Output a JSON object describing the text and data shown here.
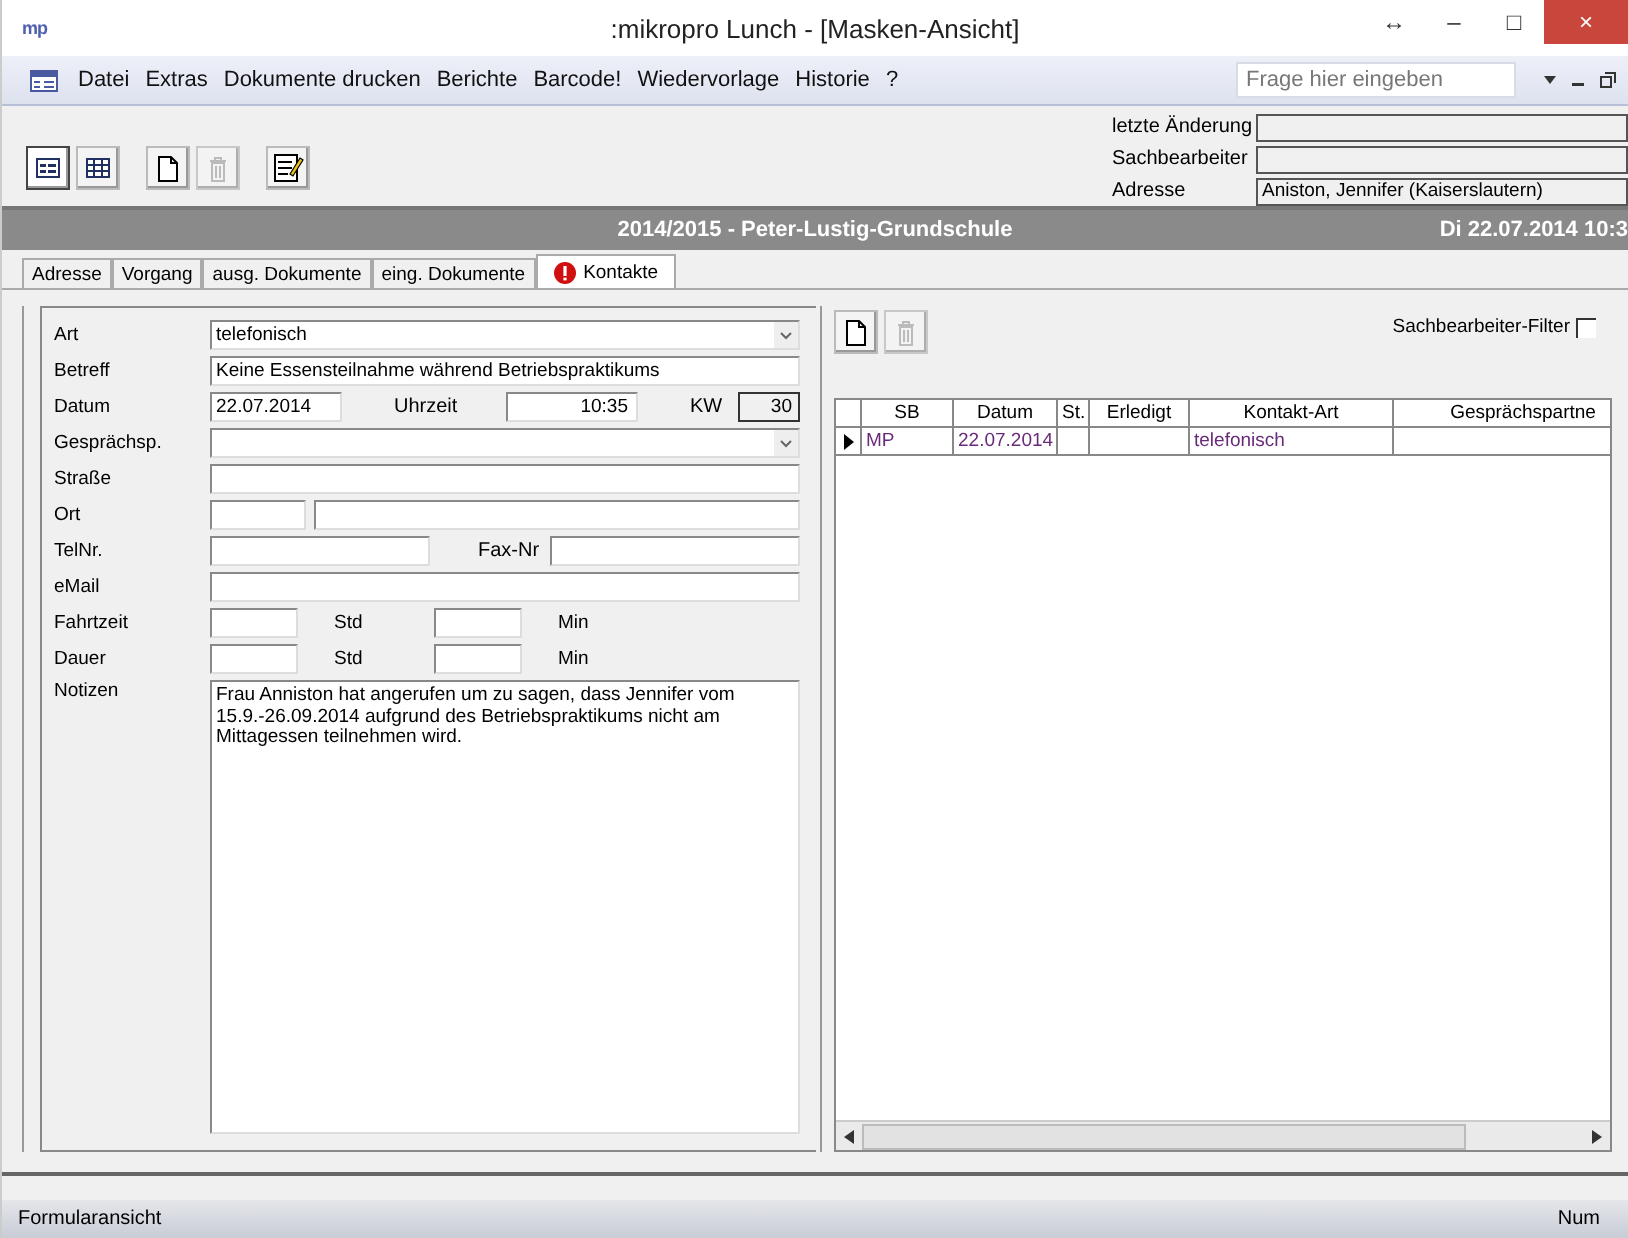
{
  "window": {
    "app_icon": "mp",
    "title": ":mikropro Lunch - [Masken-Ansicht]",
    "controls": [
      "↔",
      "–",
      "□",
      "×"
    ]
  },
  "menu": {
    "items": [
      "Datei",
      "Extras",
      "Dokumente drucken",
      "Berichte",
      "Barcode!",
      "Wiedervorlage",
      "Historie",
      "?"
    ],
    "help_search": {
      "placeholder": "Frage hier eingeben"
    }
  },
  "toolbar": {
    "buttons": [
      {
        "kind": "form-view",
        "selected": true,
        "disabled": false
      },
      {
        "kind": "table-view",
        "selected": false,
        "disabled": false
      },
      {
        "kind": "new",
        "selected": false,
        "disabled": false
      },
      {
        "kind": "delete",
        "selected": false,
        "disabled": true
      },
      {
        "kind": "edit",
        "selected": false,
        "disabled": false
      }
    ],
    "info": [
      {
        "label": "letzte Änderung"
      },
      {
        "label": "Sachbearbeiter"
      },
      {
        "label": "Adresse",
        "value": "Aniston, Jennifer (Kaiserslautern)"
      }
    ]
  },
  "header": {
    "title": "2014/2015 - Peter-Lustig-Grundschule",
    "datetime": "Di 22.07.2014 10:3"
  },
  "tabs": [
    {
      "label": "Adresse",
      "selected": false,
      "alert": false
    },
    {
      "label": "Vorgang",
      "selected": false,
      "alert": false
    },
    {
      "label": "ausg. Dokumente",
      "selected": false,
      "alert": false
    },
    {
      "label": "eing. Dokumente",
      "selected": false,
      "alert": false
    },
    {
      "label": "Kontakte",
      "selected": true,
      "alert": true
    }
  ],
  "form": {
    "art": {
      "label": "Art",
      "value": "telefonisch"
    },
    "betreff": {
      "label": "Betreff",
      "value": "Keine Essensteilnahme während Betriebspraktikums"
    },
    "datum": {
      "label": "Datum",
      "value": "22.07.2014"
    },
    "uhrzeit": {
      "label": "Uhrzeit",
      "value": "10:35"
    },
    "kw": {
      "label": "KW",
      "value": "30"
    },
    "gespraechspartner": {
      "label": "Gesprächsp."
    },
    "strasse": {
      "label": "Straße"
    },
    "ort": {
      "label": "Ort"
    },
    "telnr": {
      "label": "TelNr."
    },
    "faxnr": {
      "label": "Fax-Nr"
    },
    "email": {
      "label": "eMail"
    },
    "fahrtzeit": {
      "label": "Fahrtzeit",
      "unit_hours": "Std",
      "unit_minutes": "Min"
    },
    "dauer": {
      "label": "Dauer",
      "unit_hours": "Std",
      "unit_minutes": "Min"
    },
    "notizen": {
      "label": "Notizen",
      "value": "Frau Anniston hat angerufen um zu sagen, dass Jennifer vom 15.9.-26.09.2014 aufgrund des Betriebspraktikums nicht am Mittagessen teilnehmen wird."
    }
  },
  "contacts": {
    "filter": {
      "label": "Sachbearbeiter-Filter",
      "checked": false
    },
    "delete_disabled": true,
    "columns": [
      "SB",
      "Datum",
      "St.",
      "Erledigt",
      "Kontakt-Art",
      "Gesprächspartne"
    ],
    "rows": [
      {
        "selected": true,
        "cells": [
          "MP",
          "22.07.2014",
          "",
          "",
          "telefonisch",
          ""
        ]
      }
    ]
  },
  "status_bar": {
    "left": "Formularansicht",
    "right": "Num"
  }
}
